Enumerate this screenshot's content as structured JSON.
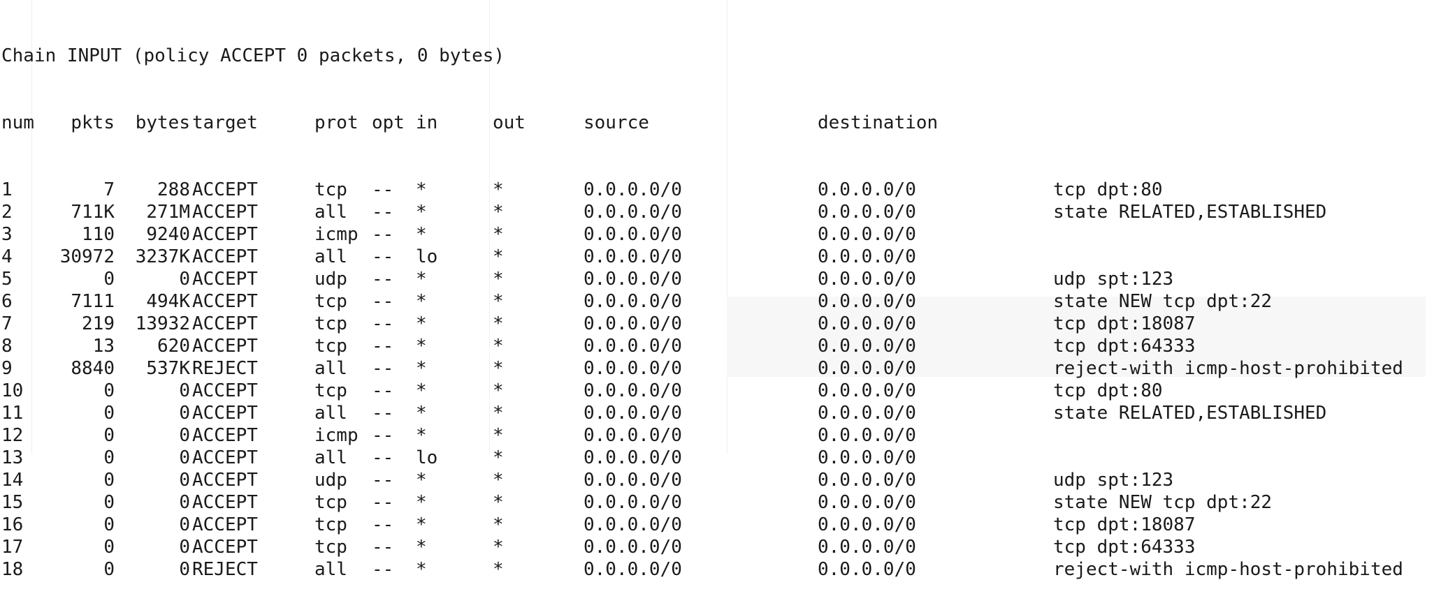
{
  "terminal": {
    "chain_header": "Chain INPUT (policy ACCEPT 0 packets, 0 bytes)",
    "columns": {
      "num": "num",
      "pkts": "pkts",
      "bytes": "bytes",
      "target": "target",
      "prot": "prot",
      "opt": "opt",
      "in": "in",
      "out": "out",
      "source": "source",
      "destination": "destination"
    },
    "rows": [
      {
        "num": "1",
        "pkts": "7",
        "bytes": "288",
        "target": "ACCEPT",
        "prot": "tcp",
        "opt": "--",
        "in": "*",
        "out": "*",
        "source": "0.0.0.0/0",
        "destination": "0.0.0.0/0",
        "extra": "tcp dpt:80"
      },
      {
        "num": "2",
        "pkts": "711K",
        "bytes": "271M",
        "target": "ACCEPT",
        "prot": "all",
        "opt": "--",
        "in": "*",
        "out": "*",
        "source": "0.0.0.0/0",
        "destination": "0.0.0.0/0",
        "extra": "state RELATED,ESTABLISHED"
      },
      {
        "num": "3",
        "pkts": "110",
        "bytes": "9240",
        "target": "ACCEPT",
        "prot": "icmp",
        "opt": "--",
        "in": "*",
        "out": "*",
        "source": "0.0.0.0/0",
        "destination": "0.0.0.0/0",
        "extra": ""
      },
      {
        "num": "4",
        "pkts": "30972",
        "bytes": "3237K",
        "target": "ACCEPT",
        "prot": "all",
        "opt": "--",
        "in": "lo",
        "out": "*",
        "source": "0.0.0.0/0",
        "destination": "0.0.0.0/0",
        "extra": ""
      },
      {
        "num": "5",
        "pkts": "0",
        "bytes": "0",
        "target": "ACCEPT",
        "prot": "udp",
        "opt": "--",
        "in": "*",
        "out": "*",
        "source": "0.0.0.0/0",
        "destination": "0.0.0.0/0",
        "extra": "udp spt:123"
      },
      {
        "num": "6",
        "pkts": "7111",
        "bytes": "494K",
        "target": "ACCEPT",
        "prot": "tcp",
        "opt": "--",
        "in": "*",
        "out": "*",
        "source": "0.0.0.0/0",
        "destination": "0.0.0.0/0",
        "extra": "state NEW tcp dpt:22"
      },
      {
        "num": "7",
        "pkts": "219",
        "bytes": "13932",
        "target": "ACCEPT",
        "prot": "tcp",
        "opt": "--",
        "in": "*",
        "out": "*",
        "source": "0.0.0.0/0",
        "destination": "0.0.0.0/0",
        "extra": "tcp dpt:18087"
      },
      {
        "num": "8",
        "pkts": "13",
        "bytes": "620",
        "target": "ACCEPT",
        "prot": "tcp",
        "opt": "--",
        "in": "*",
        "out": "*",
        "source": "0.0.0.0/0",
        "destination": "0.0.0.0/0",
        "extra": "tcp dpt:64333"
      },
      {
        "num": "9",
        "pkts": "8840",
        "bytes": "537K",
        "target": "REJECT",
        "prot": "all",
        "opt": "--",
        "in": "*",
        "out": "*",
        "source": "0.0.0.0/0",
        "destination": "0.0.0.0/0",
        "extra": "reject-with icmp-host-prohibited"
      },
      {
        "num": "10",
        "pkts": "0",
        "bytes": "0",
        "target": "ACCEPT",
        "prot": "tcp",
        "opt": "--",
        "in": "*",
        "out": "*",
        "source": "0.0.0.0/0",
        "destination": "0.0.0.0/0",
        "extra": "tcp dpt:80"
      },
      {
        "num": "11",
        "pkts": "0",
        "bytes": "0",
        "target": "ACCEPT",
        "prot": "all",
        "opt": "--",
        "in": "*",
        "out": "*",
        "source": "0.0.0.0/0",
        "destination": "0.0.0.0/0",
        "extra": "state RELATED,ESTABLISHED"
      },
      {
        "num": "12",
        "pkts": "0",
        "bytes": "0",
        "target": "ACCEPT",
        "prot": "icmp",
        "opt": "--",
        "in": "*",
        "out": "*",
        "source": "0.0.0.0/0",
        "destination": "0.0.0.0/0",
        "extra": ""
      },
      {
        "num": "13",
        "pkts": "0",
        "bytes": "0",
        "target": "ACCEPT",
        "prot": "all",
        "opt": "--",
        "in": "lo",
        "out": "*",
        "source": "0.0.0.0/0",
        "destination": "0.0.0.0/0",
        "extra": ""
      },
      {
        "num": "14",
        "pkts": "0",
        "bytes": "0",
        "target": "ACCEPT",
        "prot": "udp",
        "opt": "--",
        "in": "*",
        "out": "*",
        "source": "0.0.0.0/0",
        "destination": "0.0.0.0/0",
        "extra": "udp spt:123"
      },
      {
        "num": "15",
        "pkts": "0",
        "bytes": "0",
        "target": "ACCEPT",
        "prot": "tcp",
        "opt": "--",
        "in": "*",
        "out": "*",
        "source": "0.0.0.0/0",
        "destination": "0.0.0.0/0",
        "extra": "state NEW tcp dpt:22"
      },
      {
        "num": "16",
        "pkts": "0",
        "bytes": "0",
        "target": "ACCEPT",
        "prot": "tcp",
        "opt": "--",
        "in": "*",
        "out": "*",
        "source": "0.0.0.0/0",
        "destination": "0.0.0.0/0",
        "extra": "tcp dpt:18087"
      },
      {
        "num": "17",
        "pkts": "0",
        "bytes": "0",
        "target": "ACCEPT",
        "prot": "tcp",
        "opt": "--",
        "in": "*",
        "out": "*",
        "source": "0.0.0.0/0",
        "destination": "0.0.0.0/0",
        "extra": "tcp dpt:64333"
      },
      {
        "num": "18",
        "pkts": "0",
        "bytes": "0",
        "target": "REJECT",
        "prot": "all",
        "opt": "--",
        "in": "*",
        "out": "*",
        "source": "0.0.0.0/0",
        "destination": "0.0.0.0/0",
        "extra": "reject-with icmp-host-prohibited"
      }
    ]
  },
  "colors": {
    "background": "#ffffff",
    "text": "#1a1a1a"
  }
}
